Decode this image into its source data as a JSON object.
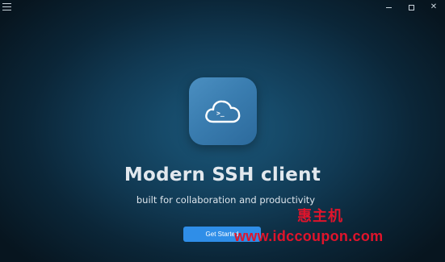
{
  "window": {
    "menu_icon": "hamburger-menu-icon",
    "controls": [
      "minimize-icon",
      "maximize-icon",
      "close-icon"
    ],
    "close_glyph": "✕"
  },
  "hero": {
    "app_icon": "cloud-terminal-icon",
    "app_icon_prompt": ">_",
    "title": "Modern SSH client",
    "subtitle": "built for collaboration and productivity",
    "cta_label": "Get Started"
  },
  "watermark": {
    "cn_text": "惠主机",
    "url_text": "www.idccoupon.com",
    "color": "#e0142b"
  },
  "colors": {
    "accent": "#2f8ee8",
    "icon_tile": "#3a7db0",
    "background_center": "#1c5577",
    "background_edge": "#07151f"
  }
}
